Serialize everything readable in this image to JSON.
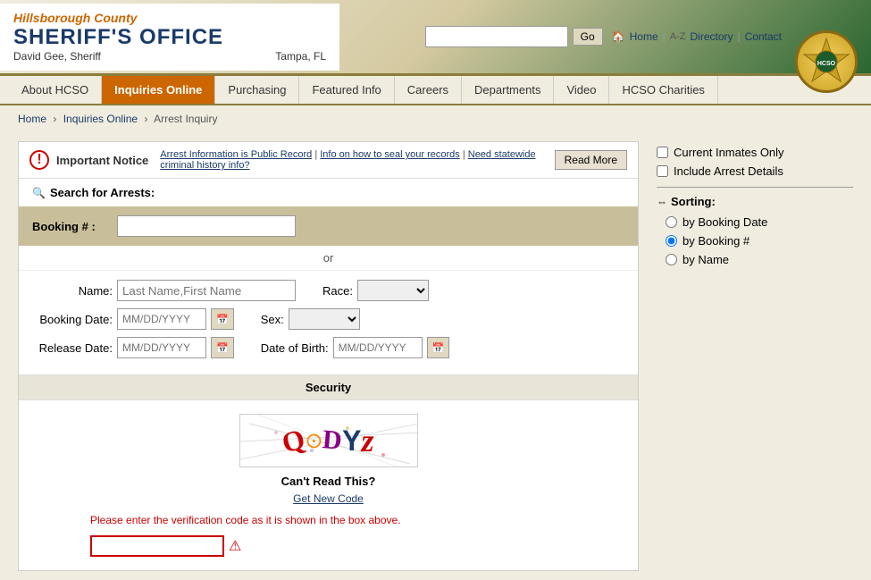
{
  "header": {
    "county": "Hillsborough County",
    "office": "SHERIFF'S OFFICE",
    "sheriff": "David Gee, Sheriff",
    "location": "Tampa, FL",
    "search_placeholder": "",
    "go_button": "Go",
    "home_link": "Home",
    "directory_link": "Directory",
    "contact_link": "Contact",
    "badge_emoji": "⭐"
  },
  "nav": {
    "items": [
      {
        "label": "About HCSO",
        "active": false
      },
      {
        "label": "Inquiries Online",
        "active": true
      },
      {
        "label": "Purchasing",
        "active": false
      },
      {
        "label": "Featured Info",
        "active": false
      },
      {
        "label": "Careers",
        "active": false
      },
      {
        "label": "Departments",
        "active": false
      },
      {
        "label": "Video",
        "active": false
      },
      {
        "label": "HCSO Charities",
        "active": false
      }
    ]
  },
  "breadcrumb": {
    "home": "Home",
    "parent": "Inquiries Online",
    "current": "Arrest Inquiry"
  },
  "notice": {
    "icon": "!",
    "title": "Important Notice",
    "text": "Arrest Information is Public Record | Info on how to seal your records | Need statewide criminal history info?",
    "read_more": "Read More"
  },
  "form": {
    "search_title": "Search for Arrests:",
    "booking_label": "Booking # :",
    "booking_placeholder": "",
    "or_text": "or",
    "name_label": "Name:",
    "name_placeholder": "Last Name,First Name",
    "booking_date_label": "Booking Date:",
    "booking_date_placeholder": "MM/DD/YYYY",
    "release_date_label": "Release Date:",
    "release_date_placeholder": "MM/DD/YYYY",
    "race_label": "Race:",
    "sex_label": "Sex:",
    "dob_label": "Date of Birth:",
    "dob_placeholder": "MM/DD/YYYY",
    "security_title": "Security",
    "cant_read": "Can't Read This?",
    "get_new_code": "Get New Code",
    "verification_msg": "Please enter the verification code as it is shown in the box above.",
    "captcha_display": "Q⊙DYz"
  },
  "sidebar": {
    "current_inmates_label": "Current Inmates Only",
    "include_arrest_label": "Include Arrest Details",
    "sorting_title": "Sorting:",
    "sort_options": [
      {
        "label": "by Booking Date",
        "value": "booking_date",
        "checked": false
      },
      {
        "label": "by Booking #",
        "value": "booking_num",
        "checked": true
      },
      {
        "label": "by Name",
        "value": "name",
        "checked": false
      }
    ]
  }
}
